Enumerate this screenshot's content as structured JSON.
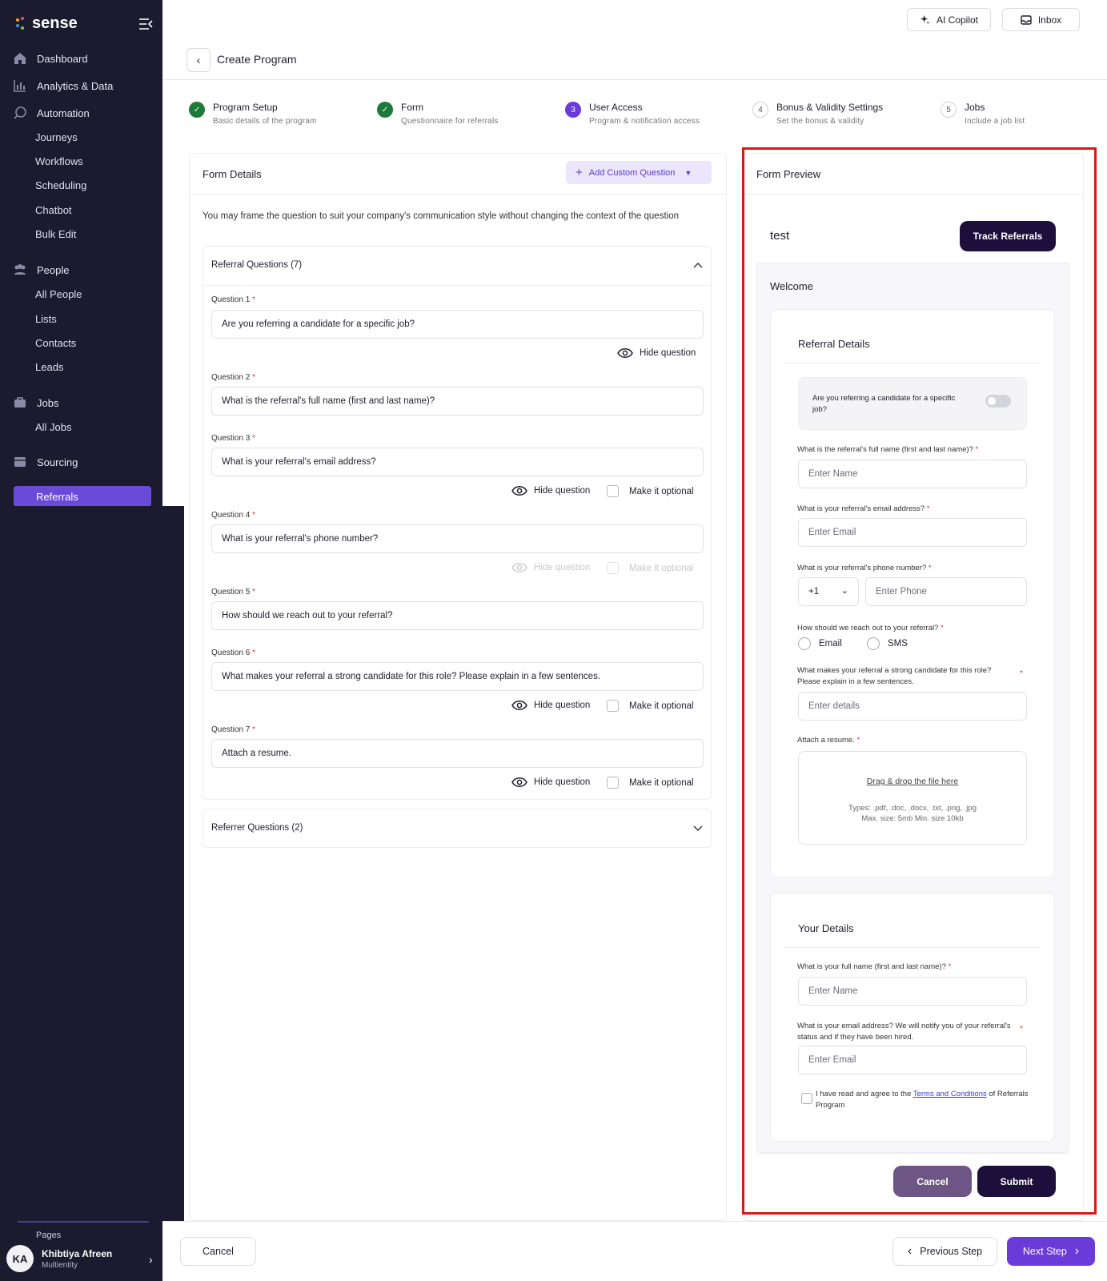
{
  "app": {
    "brand": "sense"
  },
  "sidebar": {
    "sections": [
      {
        "label": "Dashboard",
        "icon": "home-icon"
      },
      {
        "label": "Analytics & Data",
        "icon": "bar-chart-icon"
      },
      {
        "label": "Automation",
        "icon": "automation-icon"
      },
      {
        "label": "People",
        "icon": "people-icon"
      },
      {
        "label": "Jobs",
        "icon": "briefcase-icon"
      },
      {
        "label": "Sourcing",
        "icon": "sourcing-icon"
      }
    ],
    "automation_items": [
      "Journeys",
      "Workflows",
      "Scheduling",
      "Chatbot",
      "Bulk Edit"
    ],
    "people_items": [
      "All People",
      "Lists",
      "Contacts",
      "Leads"
    ],
    "jobs_items": [
      "All Jobs"
    ],
    "sourcing_items": [
      "Referrals"
    ],
    "pages_label": "Pages",
    "user": {
      "initials": "KA",
      "name": "Khibtiya Afreen",
      "role": "Multientity"
    }
  },
  "header": {
    "ai_copilot": "AI Copilot",
    "inbox": "Inbox",
    "title": "Create Program"
  },
  "steps": [
    {
      "num": "1",
      "title": "Program Setup",
      "subtitle": "Basic details of the program",
      "status": "done"
    },
    {
      "num": "2",
      "title": "Form",
      "subtitle": "Questionnaire for referrals",
      "status": "done"
    },
    {
      "num": "3",
      "title": "User Access",
      "subtitle": "Program & notification access",
      "status": "current"
    },
    {
      "num": "4",
      "title": "Bonus & Validity Settings",
      "subtitle": "Set the bonus & validity",
      "status": "todo"
    },
    {
      "num": "5",
      "title": "Jobs",
      "subtitle": "Include a job list",
      "status": "todo"
    }
  ],
  "form_details": {
    "title": "Form Details",
    "add_button": "Add Custom Question",
    "note": "You may frame the question to suit your company's communication style without changing the context of the question",
    "referral_header": "Referral Questions (7)",
    "referrer_header": "Referrer Questions (2)",
    "hide_label": "Hide question",
    "optional_label": "Make it optional",
    "questions": [
      {
        "label": "Question 1",
        "text": "Are you referring a candidate for a specific job?"
      },
      {
        "label": "Question 2",
        "text": "What is the referral's full name (first and last name)?"
      },
      {
        "label": "Question 3",
        "text": "What is your referral's email address?"
      },
      {
        "label": "Question 4",
        "text": "What is your referral's phone number?"
      },
      {
        "label": "Question 5",
        "text": "How should we reach out to your referral?"
      },
      {
        "label": "Question 6",
        "text": "What makes your referral a strong candidate for this role? Please explain in a few sentences."
      },
      {
        "label": "Question 7",
        "text": "Attach a resume."
      }
    ],
    "required_mark": "*"
  },
  "preview": {
    "title": "Form Preview",
    "program_name": "test",
    "track_button": "Track Referrals",
    "welcome": "Welcome",
    "referral_section": "Referral Details",
    "specific_job": "Are you referring a candidate for a specific job?",
    "q_name": "What is the referral's full name (first and last name)?",
    "ph_name": "Enter Name",
    "q_email": "What is your referral's email address?",
    "ph_email": "Enter Email",
    "q_phone": "What is your referral's phone number?",
    "country_code": "+1",
    "ph_phone": "Enter Phone",
    "q_reach": "How should we reach out to your referral?",
    "opt_email": "Email",
    "opt_sms": "SMS",
    "q_strong": "What makes your referral a strong candidate for this role? Please explain in a few sentences.",
    "ph_details": "Enter details",
    "q_resume": "Attach a resume.",
    "drag_drop": "Drag & drop the file here",
    "file_types": "Types: .pdf, .doc, .docx, .txt, .png, .jpg",
    "file_size": "Max. size: 5mb Min. size 10kb",
    "your_section": "Your Details",
    "q_your_name": "What is your full name (first and last name)?",
    "q_your_email": "What is your email address? We will notify you of your referral's status and if they have been hired.",
    "terms_prefix": "I have read and agree to the",
    "terms_link": "Terms and Conditions",
    "terms_suffix": "of Referrals Program",
    "cancel": "Cancel",
    "submit": "Submit",
    "required_mark": "*"
  },
  "footer": {
    "cancel": "Cancel",
    "previous": "Previous Step",
    "next": "Next Step"
  },
  "colors": {
    "sidebar": "#1c1a2e",
    "accent": "#6a3bd8",
    "success": "#1e7a3a",
    "highlight": "#e01616"
  }
}
